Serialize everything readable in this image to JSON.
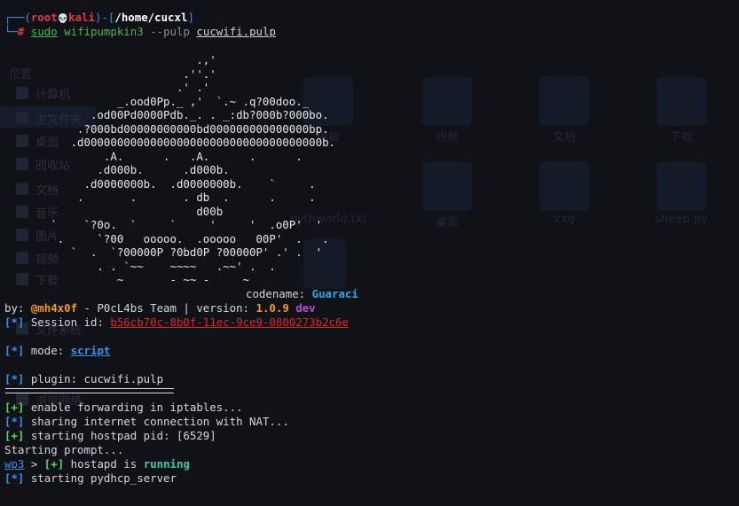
{
  "ghost_background": {
    "caption": "位置",
    "sidebar": [
      "计算机",
      "主文件夹",
      "桌面",
      "回收站",
      "文档",
      "音乐",
      "图片",
      "视频",
      "下载",
      "文件系统"
    ],
    "tiles": [
      "模板",
      "视频",
      "文档",
      "下载",
      "桌面",
      "xxq",
      "sheep.py",
      "pythworld.txt"
    ],
    "bottom_item": "浏览网络"
  },
  "terminal": {
    "prompt": {
      "open": "┌──(",
      "user": "root",
      "skull": "💀",
      "host": "kali",
      "mid": ")-[",
      "path": "/home/cucxl",
      "close": "]",
      "corner": "└─",
      "hash": "#",
      "cmd_sudo": "sudo",
      "cmd_prog": "wifipumpkin3",
      "cmd_flag": "--pulp",
      "cmd_file": "cucwifi.pulp"
    },
    "ascii_art": "                             .,'\n                           .''.'\n                          .' .'\n                 _.ood0Pp._ ,'  `.~ .q?00doo._\n             .od00Pd0000Pdb._. . _:db?000b?000bo.\n           .?000bd00000000000bd000000000000000bp.\n          .d000000000000000000000000000000000000b.\n               .A.      .   .A.      .      .\n              .d000b.      .d000b.\n            .d0000000b.  .d0000000b.    `     .\n           .       .       . db  .      .     .\n                             d00b\n       `    `?0o.  `     `     '     '  .o0P'  '\n        .     `?00   ooooo.  .ooooo   00P'  .   .\n          `  .  `?00000P ?0bd0P ?00000P' .' .  '\n              . . `~~    ~~~~   .~~' .  .\n                 ~       - ~~ -     ~",
    "codename_label": "codename: ",
    "codename_value": "Guaraci",
    "by_label": "by: ",
    "author": "@mh4x0f",
    "team_text": " - P0cL4bs Team | version: ",
    "version": "1.0.9",
    "channel": "dev",
    "session_tag": "[*]",
    "session_label": " Session id: ",
    "session_id": "b56cb70c-8b0f-11ec-9ce9-0800273b2c6e",
    "mode_tag": "[*]",
    "mode_label": " mode: ",
    "mode_value": "script",
    "plugin_tag": "[*]",
    "plugin_text": " plugin: cucwifi.pulp",
    "log": [
      {
        "tag": "[+]",
        "text": " enable forwarding in iptables..."
      },
      {
        "tag": "[*]",
        "text": " sharing internet connection with NAT..."
      },
      {
        "tag": "[+]",
        "text": " starting hostpad pid: [6529]"
      }
    ],
    "starting_prompt": "Starting prompt...",
    "wp3_prompt": "wp3",
    "wp3_arrow": " > ",
    "wp3_tag": "[+]",
    "wp3_text": " hostapd is ",
    "wp3_status": "running",
    "last_tag": "[*]",
    "last_text": " starting pydhcp_server"
  }
}
